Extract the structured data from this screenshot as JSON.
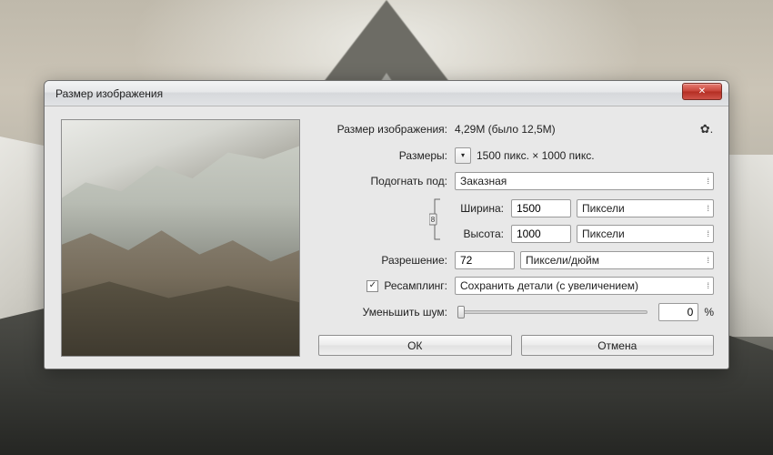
{
  "dialog": {
    "title": "Размер изображения",
    "size_label": "Размер изображения:",
    "size_value": "4,29M (было 12,5M)",
    "dimensions_label": "Размеры:",
    "dimensions_value": "1500 пикс.  ×  1000 пикс.",
    "fit_to_label": "Подогнать под:",
    "fit_to_value": "Заказная",
    "width_label": "Ширина:",
    "width_value": "1500",
    "width_unit": "Пиксели",
    "height_label": "Высота:",
    "height_value": "1000",
    "height_unit": "Пиксели",
    "resolution_label": "Разрешение:",
    "resolution_value": "72",
    "resolution_unit": "Пиксели/дюйм",
    "resample_label": "Ресамплинг:",
    "resample_value": "Сохранить детали (с увеличением)",
    "noise_label": "Уменьшить шум:",
    "noise_value": "0",
    "noise_unit": "%",
    "ok": "ОК",
    "cancel": "Отмена"
  }
}
